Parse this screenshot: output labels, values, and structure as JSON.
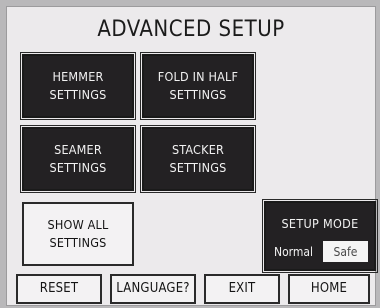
{
  "screen": {
    "title": "ADVANCED SETUP"
  },
  "buttons": {
    "hemmer": "HEMMER\nSETTINGS",
    "fold_in_half": "FOLD IN HALF\nSETTINGS",
    "seamer": "SEAMER\nSETTINGS",
    "stacker": "STACKER\nSETTINGS",
    "show_all": "SHOW ALL\nSETTINGS"
  },
  "setup_mode": {
    "title": "SETUP MODE",
    "options": [
      "Normal",
      "Safe"
    ],
    "selected": "Safe"
  },
  "bottom_bar": {
    "reset": "RESET",
    "language": "LANGUAGE?",
    "exit": "EXIT",
    "home": "HOME"
  }
}
